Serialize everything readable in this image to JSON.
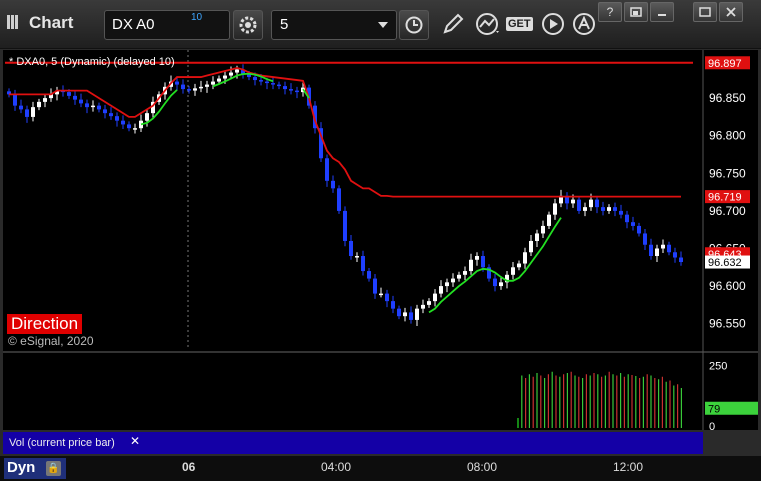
{
  "window": {
    "title": "Chart",
    "symbol": "DX A0",
    "delay_badge": "10",
    "interval": "5",
    "get_label": "GET"
  },
  "legend": {
    "text": "* DXA0, 5 (Dynamic) (delayed 10)"
  },
  "direction_label": "Direction",
  "copyright": "© eSignal, 2020",
  "volume_pane": {
    "label": "Vol (current price bar)",
    "close": "✕"
  },
  "bottom": {
    "mode": "Dyn"
  },
  "icons": [
    "app-bars-icon",
    "settings-gear-icon",
    "clock-icon",
    "pencil-icon",
    "indicator-icon",
    "get-icon",
    "play-icon",
    "alert-icon",
    "help-icon",
    "restore-icon",
    "maximize-icon",
    "close-icon",
    "lock-icon"
  ],
  "colors": {
    "background": "#000000",
    "up_candle": "#ffffff",
    "down_candle": "#1f3fff",
    "red_line": "#e01010",
    "green_line": "#22e022",
    "last_price_label": "#ffffff",
    "volume_label": "#3cd23c"
  },
  "chart_data": {
    "type": "candlestick",
    "symbol": "DX A0",
    "interval_minutes": 5,
    "y_ticks": [
      96.55,
      96.6,
      96.65,
      96.7,
      96.75,
      96.8,
      96.85
    ],
    "y_tick_labels": [
      "96.550",
      "96.600",
      "96.650",
      "96.700",
      "96.750",
      "96.800",
      "96.850"
    ],
    "ylim": [
      96.515,
      96.91
    ],
    "x_tick_labels": [
      "06",
      "04:00",
      "08:00",
      "12:00"
    ],
    "price_labels": [
      {
        "value": 96.897,
        "text": "96.897",
        "color": "#e01010"
      },
      {
        "value": 96.719,
        "text": "96.719",
        "color": "#e01010"
      },
      {
        "value": 96.643,
        "text": "96.643",
        "color": "#e01010"
      },
      {
        "value": 96.632,
        "text": "96.632",
        "color": "#ffffff"
      }
    ],
    "horizontal_line": 96.897,
    "close_series": [
      96.855,
      96.84,
      96.835,
      96.825,
      96.838,
      96.845,
      96.85,
      96.855,
      96.86,
      96.858,
      96.853,
      96.848,
      96.843,
      96.838,
      96.84,
      96.835,
      96.83,
      96.826,
      96.82,
      96.815,
      96.81,
      96.81,
      96.82,
      96.83,
      96.845,
      96.855,
      96.865,
      96.872,
      96.868,
      96.862,
      96.86,
      96.863,
      96.865,
      96.868,
      96.872,
      96.876,
      96.88,
      96.884,
      96.888,
      96.882,
      96.878,
      96.874,
      96.872,
      96.87,
      96.868,
      96.866,
      96.862,
      96.86,
      96.858,
      96.864,
      96.84,
      96.81,
      96.77,
      96.74,
      96.73,
      96.7,
      96.66,
      96.64,
      96.64,
      96.62,
      96.61,
      96.59,
      96.59,
      96.58,
      96.57,
      96.56,
      96.565,
      96.555,
      96.57,
      96.575,
      96.58,
      96.59,
      96.6,
      96.605,
      96.61,
      96.615,
      96.62,
      96.635,
      96.64,
      96.625,
      96.61,
      96.6,
      96.605,
      96.615,
      96.625,
      96.63,
      96.645,
      96.66,
      96.67,
      96.68,
      96.695,
      96.71,
      96.72,
      96.71,
      96.715,
      96.7,
      96.705,
      96.715,
      96.705,
      96.7,
      96.705,
      96.7,
      96.695,
      96.685,
      96.68,
      96.67,
      96.655,
      96.64,
      96.65,
      96.655,
      96.645,
      96.638,
      96.632
    ],
    "red_line_series": [
      96.855,
      96.855,
      96.855,
      96.855,
      96.855,
      96.855,
      96.855,
      96.855,
      96.86,
      96.86,
      96.86,
      96.86,
      96.86,
      96.86,
      96.855,
      96.85,
      96.845,
      96.84,
      96.835,
      96.83,
      96.825,
      96.825,
      96.83,
      96.835,
      96.84,
      96.85,
      96.86,
      96.87,
      96.878,
      96.878,
      96.878,
      96.878,
      96.878,
      96.88,
      96.882,
      96.884,
      96.886,
      96.888,
      96.89,
      96.888,
      96.884,
      96.882,
      96.88,
      96.879,
      96.878,
      96.877,
      96.876,
      96.875,
      96.874,
      96.873,
      96.85,
      96.82,
      96.8,
      96.78,
      96.77,
      96.765,
      96.755,
      96.74,
      96.735,
      96.73,
      96.73,
      96.725,
      96.72,
      96.72,
      96.719,
      96.719,
      96.719,
      96.719,
      96.719,
      96.719,
      96.719,
      96.719,
      96.719,
      96.719,
      96.719,
      96.719,
      96.719,
      96.719,
      96.719,
      96.719,
      96.719,
      96.719,
      96.719,
      96.719,
      96.719,
      96.719,
      96.719,
      96.719,
      96.719,
      96.719,
      96.719,
      96.719,
      96.719,
      96.719,
      96.719,
      96.719,
      96.719,
      96.719,
      96.719,
      96.719,
      96.719,
      96.719,
      96.719,
      96.719,
      96.719,
      96.719,
      96.719,
      96.719,
      96.719,
      96.719,
      96.719,
      96.719,
      96.719
    ],
    "volume": [
      40,
      210,
      200,
      215,
      205,
      220,
      210,
      200,
      215,
      225,
      210,
      205,
      215,
      220,
      225,
      210,
      205,
      200,
      215,
      210,
      220,
      215,
      205,
      210,
      225,
      215,
      210,
      220,
      205,
      215,
      212,
      208,
      200,
      205,
      215,
      210,
      200,
      195,
      205,
      185,
      190,
      170,
      175,
      160
    ],
    "volume_ticks": [
      "250",
      "0"
    ],
    "volume_last": "79"
  }
}
